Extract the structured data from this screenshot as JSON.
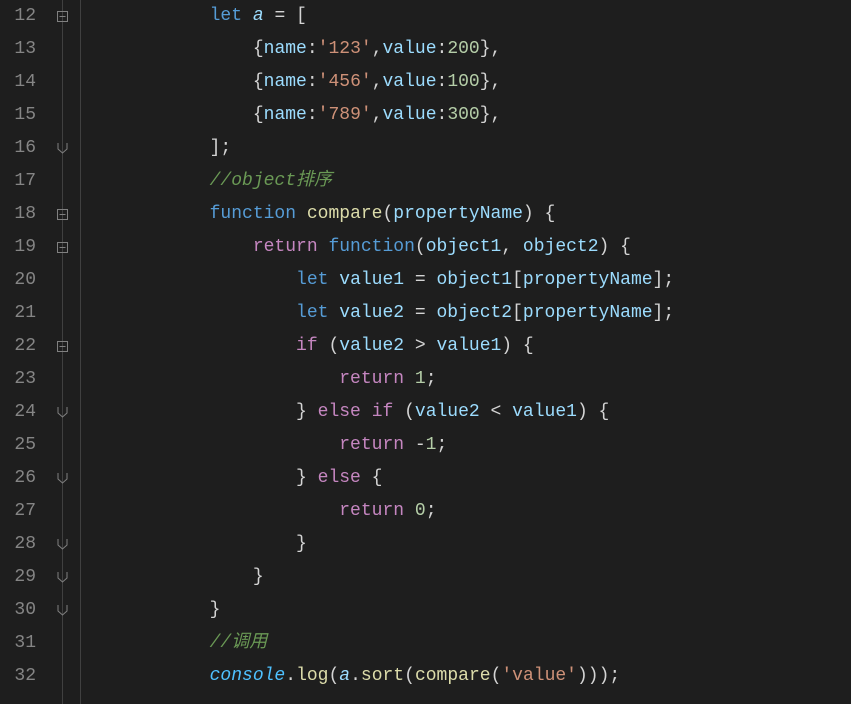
{
  "lines": {
    "l12n": "12",
    "l13n": "13",
    "l14n": "14",
    "l15n": "15",
    "l16n": "16",
    "l17n": "17",
    "l18n": "18",
    "l19n": "19",
    "l20n": "20",
    "l21n": "21",
    "l22n": "22",
    "l23n": "23",
    "l24n": "24",
    "l25n": "25",
    "l26n": "26",
    "l27n": "27",
    "l28n": "28",
    "l29n": "29",
    "l30n": "30",
    "l31n": "31",
    "l32n": "32"
  },
  "code": {
    "l12": {
      "indent": "            ",
      "let": "let",
      "sp": " ",
      "a": "a",
      "eq": " = [",
      "open": "["
    },
    "l13": {
      "indent": "                ",
      "brace": "{",
      "name": "name",
      "colon": ":",
      "str": "'123'",
      "comma": ",",
      "value": "value",
      "num": "200",
      "end": "},"
    },
    "l14": {
      "indent": "                ",
      "brace": "{",
      "name": "name",
      "colon": ":",
      "str": "'456'",
      "comma": ",",
      "value": "value",
      "num": "100",
      "end": "},"
    },
    "l15": {
      "indent": "                ",
      "brace": "{",
      "name": "name",
      "colon": ":",
      "str": "'789'",
      "comma": ",",
      "value": "value",
      "num": "300",
      "end": "},"
    },
    "l16": {
      "indent": "            ",
      "close": "];"
    },
    "l17": {
      "indent": "            ",
      "com": "//object排序"
    },
    "l18": {
      "indent": "            ",
      "fn": "function",
      "sp": " ",
      "name": "compare",
      "open": "(",
      "param": "propertyName",
      "close": ") {"
    },
    "l19": {
      "indent": "                ",
      "ret": "return",
      "sp": " ",
      "fn": "function",
      "open": "(",
      "p1": "object1",
      "comma": ", ",
      "p2": "object2",
      "close": ") {"
    },
    "l20": {
      "indent": "                    ",
      "let": "let",
      "sp": " ",
      "v": "value1",
      "eq": " = ",
      "obj": "object1",
      "open": "[",
      "prop": "propertyName",
      "close": "];"
    },
    "l21": {
      "indent": "                    ",
      "let": "let",
      "sp": " ",
      "v": "value2",
      "eq": " = ",
      "obj": "object2",
      "open": "[",
      "prop": "propertyName",
      "close": "];"
    },
    "l22": {
      "indent": "                    ",
      "if": "if",
      "sp": " (",
      "v1": "value2",
      "op": " > ",
      "v2": "value1",
      "close": ") {"
    },
    "l23": {
      "indent": "                        ",
      "ret": "return",
      "sp": " ",
      "num": "1",
      "semi": ";"
    },
    "l24": {
      "indent": "                    ",
      "close": "} ",
      "else": "else",
      "sp": " ",
      "if": "if",
      "open": " (",
      "v1": "value2",
      "op": " < ",
      "v2": "value1",
      "close2": ") {"
    },
    "l25": {
      "indent": "                        ",
      "ret": "return",
      "sp": " -",
      "num": "1",
      "semi": ";"
    },
    "l26": {
      "indent": "                    ",
      "close": "} ",
      "else": "else",
      "open": " {"
    },
    "l27": {
      "indent": "                        ",
      "ret": "return",
      "sp": " ",
      "num": "0",
      "semi": ";"
    },
    "l28": {
      "indent": "                    ",
      "close": "}"
    },
    "l29": {
      "indent": "                ",
      "close": "}"
    },
    "l30": {
      "indent": "            ",
      "close": "}"
    },
    "l31": {
      "indent": "            ",
      "com": "//调用"
    },
    "l32": {
      "indent": "            ",
      "console": "console",
      "dot": ".",
      "log": "log",
      "open": "(",
      "a": "a",
      "dot2": ".",
      "sort": "sort",
      "open2": "(",
      "compare": "compare",
      "open3": "(",
      "str": "'value'",
      "close": ")));"
    }
  }
}
